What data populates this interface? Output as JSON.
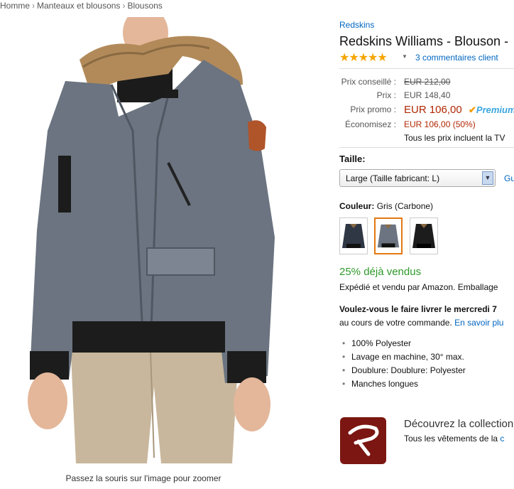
{
  "breadcrumb": [
    "Homme",
    "Manteaux et blousons",
    "Blousons"
  ],
  "image": {
    "zoom_hint": "Passez la souris sur l'image pour zoomer"
  },
  "product": {
    "brand": "Redskins",
    "title": "Redskins Williams - Blouson -",
    "rating_stars": "★★★★★",
    "rating": 5,
    "reviews": "3 commentaires client"
  },
  "pricing": {
    "list_label": "Prix conseillé :",
    "list_value": "EUR 212,00",
    "price_label": "Prix :",
    "price_value": "EUR 148,40",
    "promo_label": "Prix promo :",
    "promo_value": "EUR 106,00",
    "prime": "Premium",
    "save_label": "Économisez :",
    "save_value": "EUR 106,00 (50%)",
    "tax_note": "Tous les prix incluent la TV"
  },
  "size": {
    "label": "Taille:",
    "selected": "Large (Taille fabricant: L)",
    "guide": "Gu"
  },
  "color": {
    "label": "Couleur:",
    "value": "Gris (Carbone)",
    "swatches": [
      "navy",
      "grey",
      "black"
    ],
    "selected_index": 1
  },
  "availability": {
    "sold": "25% déjà vendus",
    "shipped": "Expédié et vendu par Amazon. Emballage",
    "delivery_question": "Voulez-vous le faire livrer le mercredi 7",
    "delivery_sub": "au cours de votre commande.",
    "delivery_link": "En savoir plu"
  },
  "features": [
    "100% Polyester",
    "Lavage en machine, 30° max.",
    "Doublure: Doublure: Polyester",
    "Manches longues"
  ],
  "promo": {
    "title": "Découvrez la collection",
    "sub": "Tous les vêtements de la",
    "link": "c"
  },
  "colors": {
    "link": "#0066c0",
    "price_red": "#b12704",
    "sold_green": "#2e9a2a",
    "star": "#f5a500",
    "brand_logo": "#7b1612"
  }
}
